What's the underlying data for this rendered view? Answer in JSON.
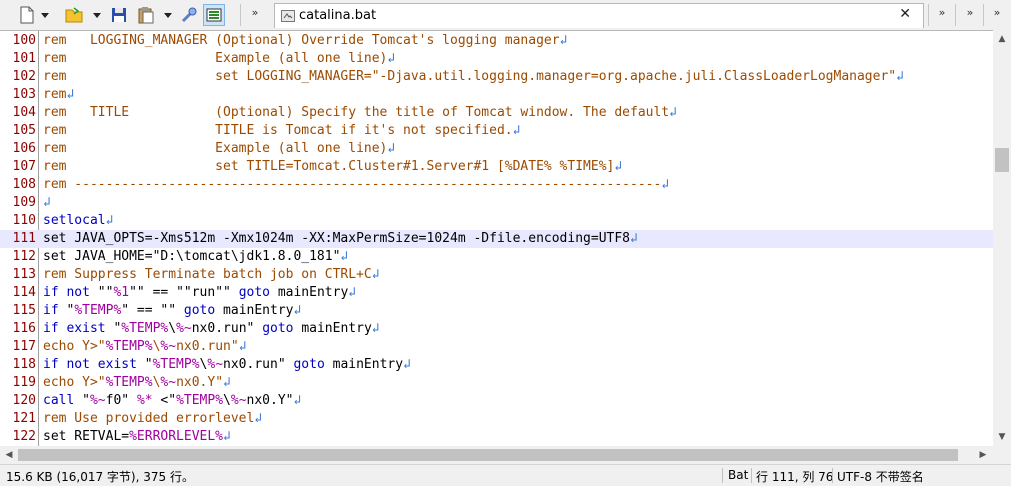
{
  "toolbar": {
    "icons": [
      "new-file-icon",
      "dropdown-arrow-icon",
      "open-folder-icon",
      "dropdown-arrow-icon",
      "save-icon",
      "paste-icon",
      "dropdown-arrow-icon",
      "tools-icon",
      "panel-icon"
    ],
    "overflow_glyph": "»"
  },
  "tab": {
    "label": "catalina.bat",
    "close_glyph": "✕"
  },
  "editor": {
    "lines": [
      {
        "num": "100",
        "parts": [
          [
            "rem   LOGGING_MANAGER (Optional) Override Tomcat's logging manager",
            "rem"
          ]
        ]
      },
      {
        "num": "101",
        "parts": [
          [
            "rem                   Example (all one line)",
            "rem"
          ]
        ]
      },
      {
        "num": "102",
        "parts": [
          [
            "rem                   set LOGGING_MANAGER=\"-Djava.util.logging.manager=org.apache.juli.ClassLoaderLogManager\"",
            "rem"
          ]
        ]
      },
      {
        "num": "103",
        "parts": [
          [
            "rem",
            "rem"
          ]
        ]
      },
      {
        "num": "104",
        "parts": [
          [
            "rem   TITLE           (Optional) Specify the title of Tomcat window. The default",
            "rem"
          ]
        ]
      },
      {
        "num": "105",
        "parts": [
          [
            "rem                   TITLE is Tomcat if it's not specified.",
            "rem"
          ]
        ]
      },
      {
        "num": "106",
        "parts": [
          [
            "rem                   Example (all one line)",
            "rem"
          ]
        ]
      },
      {
        "num": "107",
        "parts": [
          [
            "rem                   set TITLE=Tomcat.Cluster#1.Server#1 [%DATE% %TIME%]",
            "rem"
          ]
        ]
      },
      {
        "num": "108",
        "parts": [
          [
            "rem ---------------------------------------------------------------------------",
            "rem"
          ]
        ]
      },
      {
        "num": "109",
        "parts": []
      },
      {
        "num": "110",
        "parts": [
          [
            "setlocal",
            "kw"
          ]
        ]
      },
      {
        "num": "111",
        "current": true,
        "parts": [
          [
            "set JAVA_OPTS=-Xms512m -Xmx1024m -XX:MaxPermSize=1024m -Dfile.encoding=UTF8",
            "txt"
          ]
        ]
      },
      {
        "num": "112",
        "parts": [
          [
            "set JAVA_HOME=\"D:\\tomcat\\jdk1.8.0_181\"",
            "txt"
          ]
        ]
      },
      {
        "num": "113",
        "parts": [
          [
            "rem Suppress Terminate batch job on CTRL+C",
            "rem"
          ]
        ]
      },
      {
        "num": "114",
        "parts": [
          [
            "if not",
            "kw"
          ],
          [
            " \"\"",
            "txt"
          ],
          [
            "%1",
            "var"
          ],
          [
            "\"\" == \"\"run\"\" ",
            "txt"
          ],
          [
            "goto",
            "kw"
          ],
          [
            " mainEntry",
            "txt"
          ]
        ]
      },
      {
        "num": "115",
        "parts": [
          [
            "if",
            "kw"
          ],
          [
            " \"",
            "txt"
          ],
          [
            "%TEMP%",
            "var"
          ],
          [
            "\" == \"\" ",
            "txt"
          ],
          [
            "goto",
            "kw"
          ],
          [
            " mainEntry",
            "txt"
          ]
        ]
      },
      {
        "num": "116",
        "parts": [
          [
            "if exist",
            "kw"
          ],
          [
            " \"",
            "txt"
          ],
          [
            "%TEMP%",
            "var"
          ],
          [
            "\\",
            "txt"
          ],
          [
            "%~",
            "var"
          ],
          [
            "nx0.run\" ",
            "txt"
          ],
          [
            "goto",
            "kw"
          ],
          [
            " mainEntry",
            "txt"
          ]
        ]
      },
      {
        "num": "117",
        "parts": [
          [
            "echo Y>\"",
            "rem"
          ],
          [
            "%TEMP%",
            "var"
          ],
          [
            "\\",
            "rem"
          ],
          [
            "%~",
            "var"
          ],
          [
            "nx0.run\"",
            "rem"
          ]
        ]
      },
      {
        "num": "118",
        "parts": [
          [
            "if not exist",
            "kw"
          ],
          [
            " \"",
            "txt"
          ],
          [
            "%TEMP%",
            "var"
          ],
          [
            "\\",
            "txt"
          ],
          [
            "%~",
            "var"
          ],
          [
            "nx0.run\" ",
            "txt"
          ],
          [
            "goto",
            "kw"
          ],
          [
            " mainEntry",
            "txt"
          ]
        ]
      },
      {
        "num": "119",
        "parts": [
          [
            "echo Y>\"",
            "rem"
          ],
          [
            "%TEMP%",
            "var"
          ],
          [
            "\\",
            "rem"
          ],
          [
            "%~",
            "var"
          ],
          [
            "nx0.Y\"",
            "rem"
          ]
        ]
      },
      {
        "num": "120",
        "parts": [
          [
            "call",
            "kw"
          ],
          [
            " \"",
            "txt"
          ],
          [
            "%~",
            "var"
          ],
          [
            "f0\" ",
            "txt"
          ],
          [
            "%*",
            "var"
          ],
          [
            " <\"",
            "txt"
          ],
          [
            "%TEMP%",
            "var"
          ],
          [
            "\\",
            "txt"
          ],
          [
            "%~",
            "var"
          ],
          [
            "nx0.Y\"",
            "txt"
          ]
        ]
      },
      {
        "num": "121",
        "parts": [
          [
            "rem Use provided errorlevel",
            "rem"
          ]
        ]
      },
      {
        "num": "122",
        "parts": [
          [
            "set RETVAL=",
            "txt"
          ],
          [
            "%ERRORLEVEL%",
            "var"
          ]
        ]
      }
    ],
    "eol_glyph": "↲"
  },
  "scrollbars": {
    "up": "▲",
    "down": "▼",
    "left": "◀",
    "right": "▶"
  },
  "status": {
    "file_info": "15.6 KB (16,017 字节),  375 行。",
    "language": "Bat",
    "position": "行 111, 列 76",
    "encoding": "UTF-8 不带签名"
  },
  "colors": {
    "rem": "#9b4a00",
    "keyword": "#0000c0",
    "variable": "#a000a0",
    "line_number": "#8b0000",
    "eol_marker": "#3a7ad8"
  }
}
